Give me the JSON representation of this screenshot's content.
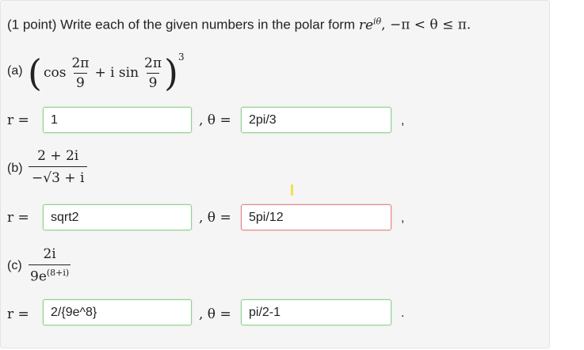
{
  "prompt": {
    "points": "(1 point)",
    "text": "Write each of the given numbers in the polar form",
    "form": "re",
    "form_exp": "iθ",
    "range": ", −π < θ ≤ π."
  },
  "parts": [
    {
      "label": "(a)",
      "cos": "cos",
      "sin": "+ i sin",
      "num1": "2π",
      "den1": "9",
      "num2": "2π",
      "den2": "9",
      "power": "3",
      "r_label": "r =",
      "r_value": "1",
      "theta_label": ", θ =",
      "theta_value": "2pi/3",
      "end": ","
    },
    {
      "label": "(b)",
      "numerator": "2 + 2i",
      "denominator": "−√3 + i",
      "r_label": "r =",
      "r_value": "sqrt2",
      "theta_label": ", θ =",
      "theta_value": "5pi/12",
      "end": ","
    },
    {
      "label": "(c)",
      "numerator": "2i",
      "denominator": "9e",
      "denominator_exp": "(8+i)",
      "r_label": "r =",
      "r_value": "2/{9e^8}",
      "theta_label": ", θ =",
      "theta_value": "pi/2-1",
      "end": "."
    }
  ],
  "colors": {
    "correct_border": "#8fcf8f",
    "incorrect_border": "#e08585",
    "panel_bg": "#f5f5f5"
  }
}
